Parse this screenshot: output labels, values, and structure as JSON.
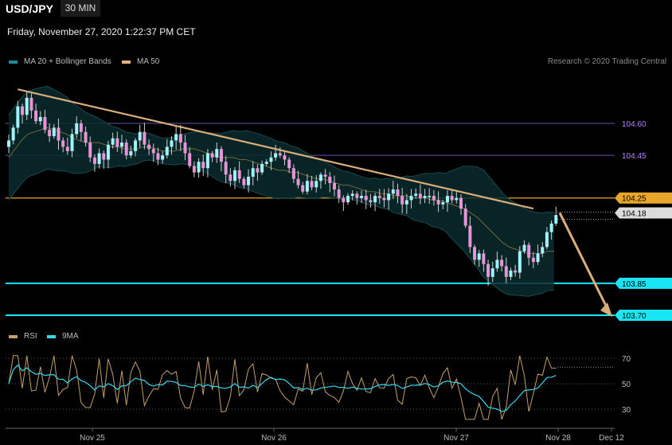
{
  "header": {
    "symbol": "USD/JPY",
    "timeframe": "30 MIN",
    "datetime": "Friday, November 27, 2020 1:22:37 PM CET"
  },
  "legend_main": [
    {
      "label": "MA 20 + Bollinger Bands",
      "color": "#1f8a96"
    },
    {
      "label": "MA 50",
      "color": "#e4b27a"
    }
  ],
  "legend_rsi": [
    {
      "label": "RSI",
      "color": "#c4a06a"
    },
    {
      "label": "9MA",
      "color": "#34d8ee"
    }
  ],
  "copyright": "Research © 2020 Trading Central",
  "colors": {
    "bull": "#9ff3fb",
    "bear": "#e795d6",
    "trend": "#d9ae79",
    "resistance": "#e8a72b",
    "support": "#19e6f5",
    "minor": "#6b4ba8",
    "current": "#dcdcdc"
  },
  "chart_data": {
    "type": "candlestick",
    "price_axis": {
      "ylim": [
        103.62,
        104.88
      ]
    },
    "x_tick_labels": [
      "Nov 25",
      "Nov 26",
      "Nov 27",
      "Nov 28",
      "Dec 12"
    ],
    "levels": [
      {
        "value": 104.6,
        "label": "104.60",
        "kind": "minor"
      },
      {
        "value": 104.45,
        "label": "104.45",
        "kind": "minor"
      },
      {
        "value": 104.25,
        "label": "104.25",
        "kind": "resistance"
      },
      {
        "value": 104.18,
        "label": "104.18",
        "kind": "current"
      },
      {
        "value": 103.85,
        "label": "103.85",
        "kind": "support"
      },
      {
        "value": 103.7,
        "label": "103.70",
        "kind": "support"
      }
    ],
    "closes": [
      104.52,
      104.58,
      104.68,
      104.64,
      104.72,
      104.66,
      104.61,
      104.63,
      104.57,
      104.54,
      104.58,
      104.52,
      104.49,
      104.47,
      104.55,
      104.6,
      104.56,
      104.51,
      104.44,
      104.41,
      104.46,
      104.43,
      104.5,
      104.53,
      104.49,
      104.51,
      104.45,
      104.47,
      104.52,
      104.56,
      104.5,
      104.48,
      104.46,
      104.43,
      104.45,
      104.49,
      104.52,
      104.55,
      104.51,
      104.46,
      104.4,
      104.37,
      104.42,
      104.39,
      104.46,
      104.44,
      104.48,
      104.42,
      104.36,
      104.33,
      104.38,
      104.34,
      104.31,
      104.35,
      104.39,
      104.37,
      104.41,
      104.42,
      104.44,
      104.46,
      104.45,
      104.43,
      104.39,
      104.34,
      104.31,
      104.28,
      104.33,
      104.3,
      104.33,
      104.36,
      104.35,
      104.32,
      104.29,
      104.25,
      104.23,
      104.26,
      104.27,
      104.25,
      104.26,
      104.24,
      104.23,
      104.26,
      104.25,
      104.24,
      104.27,
      104.29,
      104.26,
      104.22,
      104.24,
      104.26,
      104.27,
      104.25,
      104.26,
      104.26,
      104.24,
      104.22,
      104.23,
      104.26,
      104.24,
      104.25,
      104.2,
      104.12,
      104.02,
      103.96,
      103.99,
      103.94,
      103.88,
      103.92,
      103.96,
      103.93,
      103.88,
      103.91,
      103.9,
      104.0,
      104.03,
      103.97,
      103.95,
      103.99,
      104.02,
      104.09,
      104.13,
      104.17
    ],
    "ma20": [
      104.44,
      104.48,
      104.52,
      104.55,
      104.56,
      104.57,
      104.58,
      104.57,
      104.56,
      104.55,
      104.53,
      104.52,
      104.51,
      104.51,
      104.51,
      104.5,
      104.49,
      104.49,
      104.48,
      104.48,
      104.48,
      104.49,
      104.49,
      104.48,
      104.47,
      104.47,
      104.47,
      104.48,
      104.48,
      104.48,
      104.47,
      104.46,
      104.45,
      104.44,
      104.44,
      104.44,
      104.43,
      104.43,
      104.42,
      104.41,
      104.4,
      104.39,
      104.38,
      104.38,
      104.37,
      104.37,
      104.36,
      104.35,
      104.34,
      104.34,
      104.33,
      104.32,
      104.31,
      104.31,
      104.3,
      104.29,
      104.28,
      104.28,
      104.27,
      104.27,
      104.26,
      104.26,
      104.26,
      104.25,
      104.25,
      104.25,
      104.24,
      104.24,
      104.23,
      104.22,
      104.21,
      104.2,
      104.18,
      104.16,
      104.13,
      104.1,
      104.07,
      104.04,
      104.02,
      104.01,
      104.0,
      103.99,
      103.99,
      103.99,
      104.0,
      104.0
    ],
    "ma50_segments": [
      {
        "from_bar": 2,
        "from": 104.76,
        "to_bar": 116,
        "to": 104.2
      }
    ],
    "projection": {
      "from": 104.18,
      "to": 103.7
    },
    "rsi_axis": {
      "ylim": [
        20,
        80
      ],
      "ticks": [
        70,
        50,
        30
      ]
    },
    "rsi_last": 63
  }
}
